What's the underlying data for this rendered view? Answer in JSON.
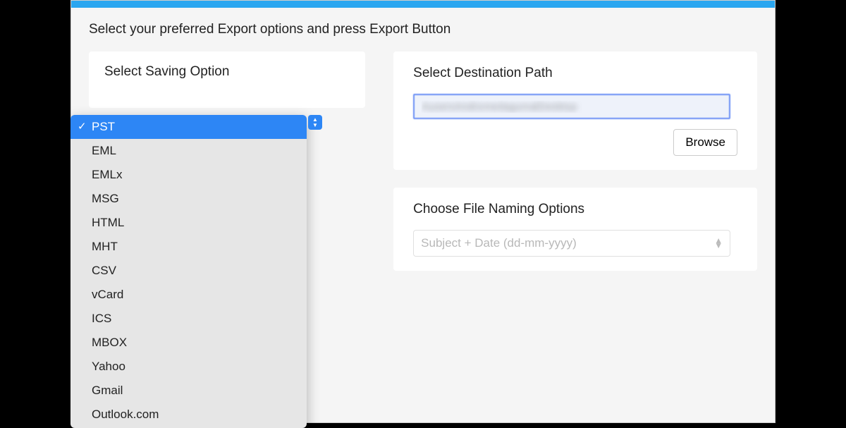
{
  "instruction": "Select your preferred Export options and press Export Button",
  "left_panel": {
    "title": "Select Saving Option"
  },
  "saving_options": {
    "selected": "PST",
    "items": [
      "PST",
      "EML",
      "EMLx",
      "MSG",
      "HTML",
      "MHT",
      "CSV",
      "vCard",
      "ICS",
      "MBOX",
      "Yahoo",
      "Gmail",
      "Outlook.com"
    ]
  },
  "destination": {
    "title": "Select Destination Path",
    "value": "AusersAndromedagumalDesktop",
    "browse_label": "Browse"
  },
  "naming": {
    "title": "Choose File Naming Options",
    "placeholder": "Subject + Date (dd-mm-yyyy)"
  }
}
